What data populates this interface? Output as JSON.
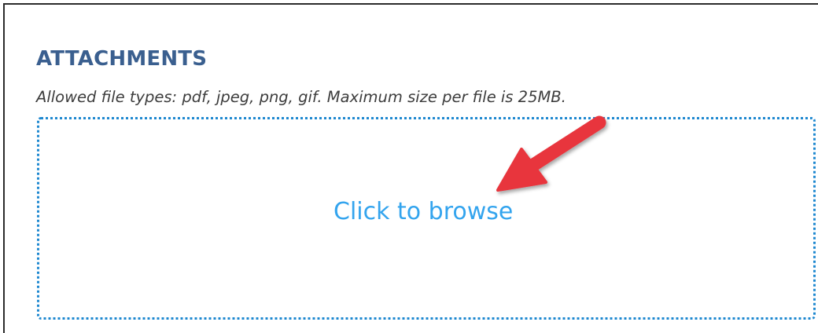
{
  "attachments": {
    "title": "ATTACHMENTS",
    "allowed_types_note": "Allowed file types: pdf, jpeg, png, gif. Maximum size per file is 25MB.",
    "dropzone": {
      "browse_label": "Click to browse"
    }
  },
  "annotation": {
    "arrow_icon": "red-pointer-arrow",
    "color": "#e8353e"
  },
  "colors": {
    "title": "#3a5f8f",
    "link": "#33a4ee",
    "dropzone_border": "#1e88d0"
  }
}
